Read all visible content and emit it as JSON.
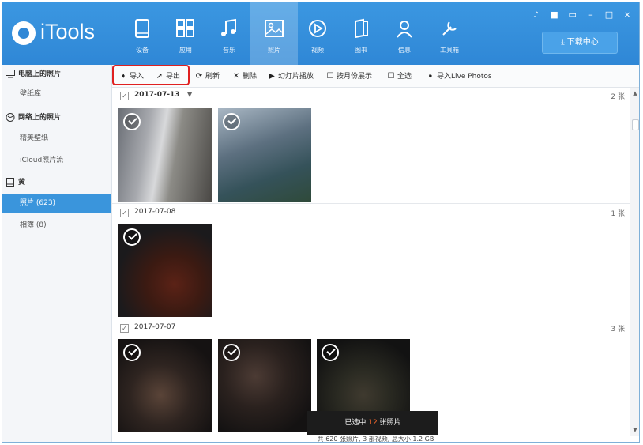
{
  "app": {
    "logo_text": "iTools"
  },
  "nav": [
    {
      "label": "设备",
      "icon": "device-icon"
    },
    {
      "label": "应用",
      "icon": "apps-icon"
    },
    {
      "label": "音乐",
      "icon": "music-icon"
    },
    {
      "label": "照片",
      "icon": "photo-icon"
    },
    {
      "label": "视频",
      "icon": "video-icon"
    },
    {
      "label": "图书",
      "icon": "book-icon"
    },
    {
      "label": "信息",
      "icon": "contact-icon"
    },
    {
      "label": "工具箱",
      "icon": "tools-icon"
    }
  ],
  "header": {
    "download_center": "下载中心"
  },
  "window_controls": [
    "♪",
    "■",
    "▭",
    "–",
    "□",
    "×"
  ],
  "sidebar": {
    "items": [
      {
        "label": "电脑上的照片"
      },
      {
        "label": "壁纸库"
      },
      {
        "label": "网络上的照片"
      },
      {
        "label": "精美壁纸"
      },
      {
        "label": "iCloud照片流"
      },
      {
        "label": "黄"
      },
      {
        "label": "照片 (623)"
      },
      {
        "label": "相簿 (8)"
      }
    ]
  },
  "toolbar": {
    "import": "导入",
    "export": "导出",
    "refresh": "刷新",
    "delete": "删除",
    "slideshow": "幻灯片播放",
    "by_month": "按月份展示",
    "select_all": "全选",
    "import_live": "导入Live Photos"
  },
  "groups": [
    {
      "date": "2017-07-13",
      "count": "2 张"
    },
    {
      "date": "2017-07-08",
      "count": "1 张"
    },
    {
      "date": "2017-07-07",
      "count": "3 张"
    }
  ],
  "selection": {
    "prefix": "已选中",
    "count": "12",
    "suffix": "张照片"
  },
  "footer": "共 620 张照片, 3 部视频, 总大小 1.2 GB",
  "colors": {
    "header_blue": "#2f87d6",
    "active_blue": "#3a95dc",
    "highlight_red": "#e02020",
    "selected_count": "#ff6a2c"
  }
}
